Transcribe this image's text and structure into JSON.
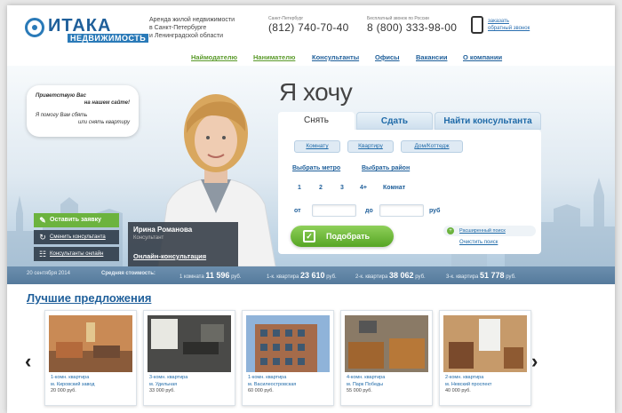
{
  "header": {
    "logo_text": "ИТАКА",
    "logo_sub": "НЕДВИЖИМОСТЬ",
    "tagline": [
      "Аренда жилой недвижимости",
      "в Санкт-Петербурге",
      "и Ленинградской области"
    ],
    "phone_spb_label": "Санкт-Петербург",
    "phone_spb": "(812) 740-70-40",
    "phone_ru_label": "Бесплатный звонок по России",
    "phone_ru": "8 (800) 333-98-00",
    "callback": [
      "заказать",
      "обратный звонок"
    ]
  },
  "nav": {
    "items": [
      {
        "label": "Наймодателю",
        "color": "#5a9a2a"
      },
      {
        "label": "Нанимателю",
        "color": "#5a9a2a"
      },
      {
        "label": "Консультанты",
        "color": "#1f5f9a"
      },
      {
        "label": "Офисы",
        "color": "#1f5f9a"
      },
      {
        "label": "Вакансии",
        "color": "#1f5f9a"
      },
      {
        "label": "О компании",
        "color": "#1f5f9a"
      }
    ]
  },
  "hero": {
    "bubble": [
      "Приветствую Вас",
      "на нашем сайте!",
      "Я помогу Вам сбять",
      "или снять квартиру"
    ],
    "left_buttons": [
      {
        "label": "Оставить заявку",
        "icon": "✎",
        "style": "green"
      },
      {
        "label": "Сменить консультанта",
        "icon": "↻",
        "style": "dark"
      },
      {
        "label": "Консультанты онлайн",
        "icon": "☷",
        "style": "dark"
      }
    ],
    "consultant_name": "Ирина Романова",
    "consultant_role": "Консультант",
    "online_link": "Онлайн-консультация",
    "want_heading": "Я хочу"
  },
  "search": {
    "tabs": [
      "Снять",
      "Сдать",
      "Найти консультанта"
    ],
    "chips": [
      "Комнату",
      "Квартиру",
      "Дом/Коттедж"
    ],
    "choose_metro": "Выбрать метро",
    "choose_district": "Выбрать район",
    "rooms": [
      "1",
      "2",
      "3",
      "4+",
      "Комнат"
    ],
    "price_from": "от",
    "price_to": "до",
    "currency": "руб",
    "find_button": "Подобрать",
    "advanced": "Расширенный поиск",
    "clear": "Очистить поиск"
  },
  "stats": {
    "date": "20 сентября 2014",
    "label": "Средняя стоимость:",
    "items": [
      {
        "label": "1 комната",
        "value": "11 596",
        "unit": "руб."
      },
      {
        "label": "1-к. квартира",
        "value": "23 610",
        "unit": "руб."
      },
      {
        "label": "2-к. квартира",
        "value": "38 062",
        "unit": "руб."
      },
      {
        "label": "3-к. квартира",
        "value": "51 778",
        "unit": "руб."
      }
    ]
  },
  "offers": {
    "title": "Лучшие предложения",
    "cards": [
      {
        "type": "1-комн. квартира",
        "location": "м. Кировский завод",
        "price": "20 000 руб."
      },
      {
        "type": "3-комн. квартира",
        "location": "м. Удельная",
        "price": "33 000 руб."
      },
      {
        "type": "1-комн. квартира",
        "location": "м. Василеостровская",
        "price": "60 000 руб."
      },
      {
        "type": "4-комн. квартира",
        "location": "м. Парк Победы",
        "price": "55 000 руб."
      },
      {
        "type": "2-комн. квартира",
        "location": "м. Невский проспект",
        "price": "40 000 руб."
      }
    ]
  }
}
